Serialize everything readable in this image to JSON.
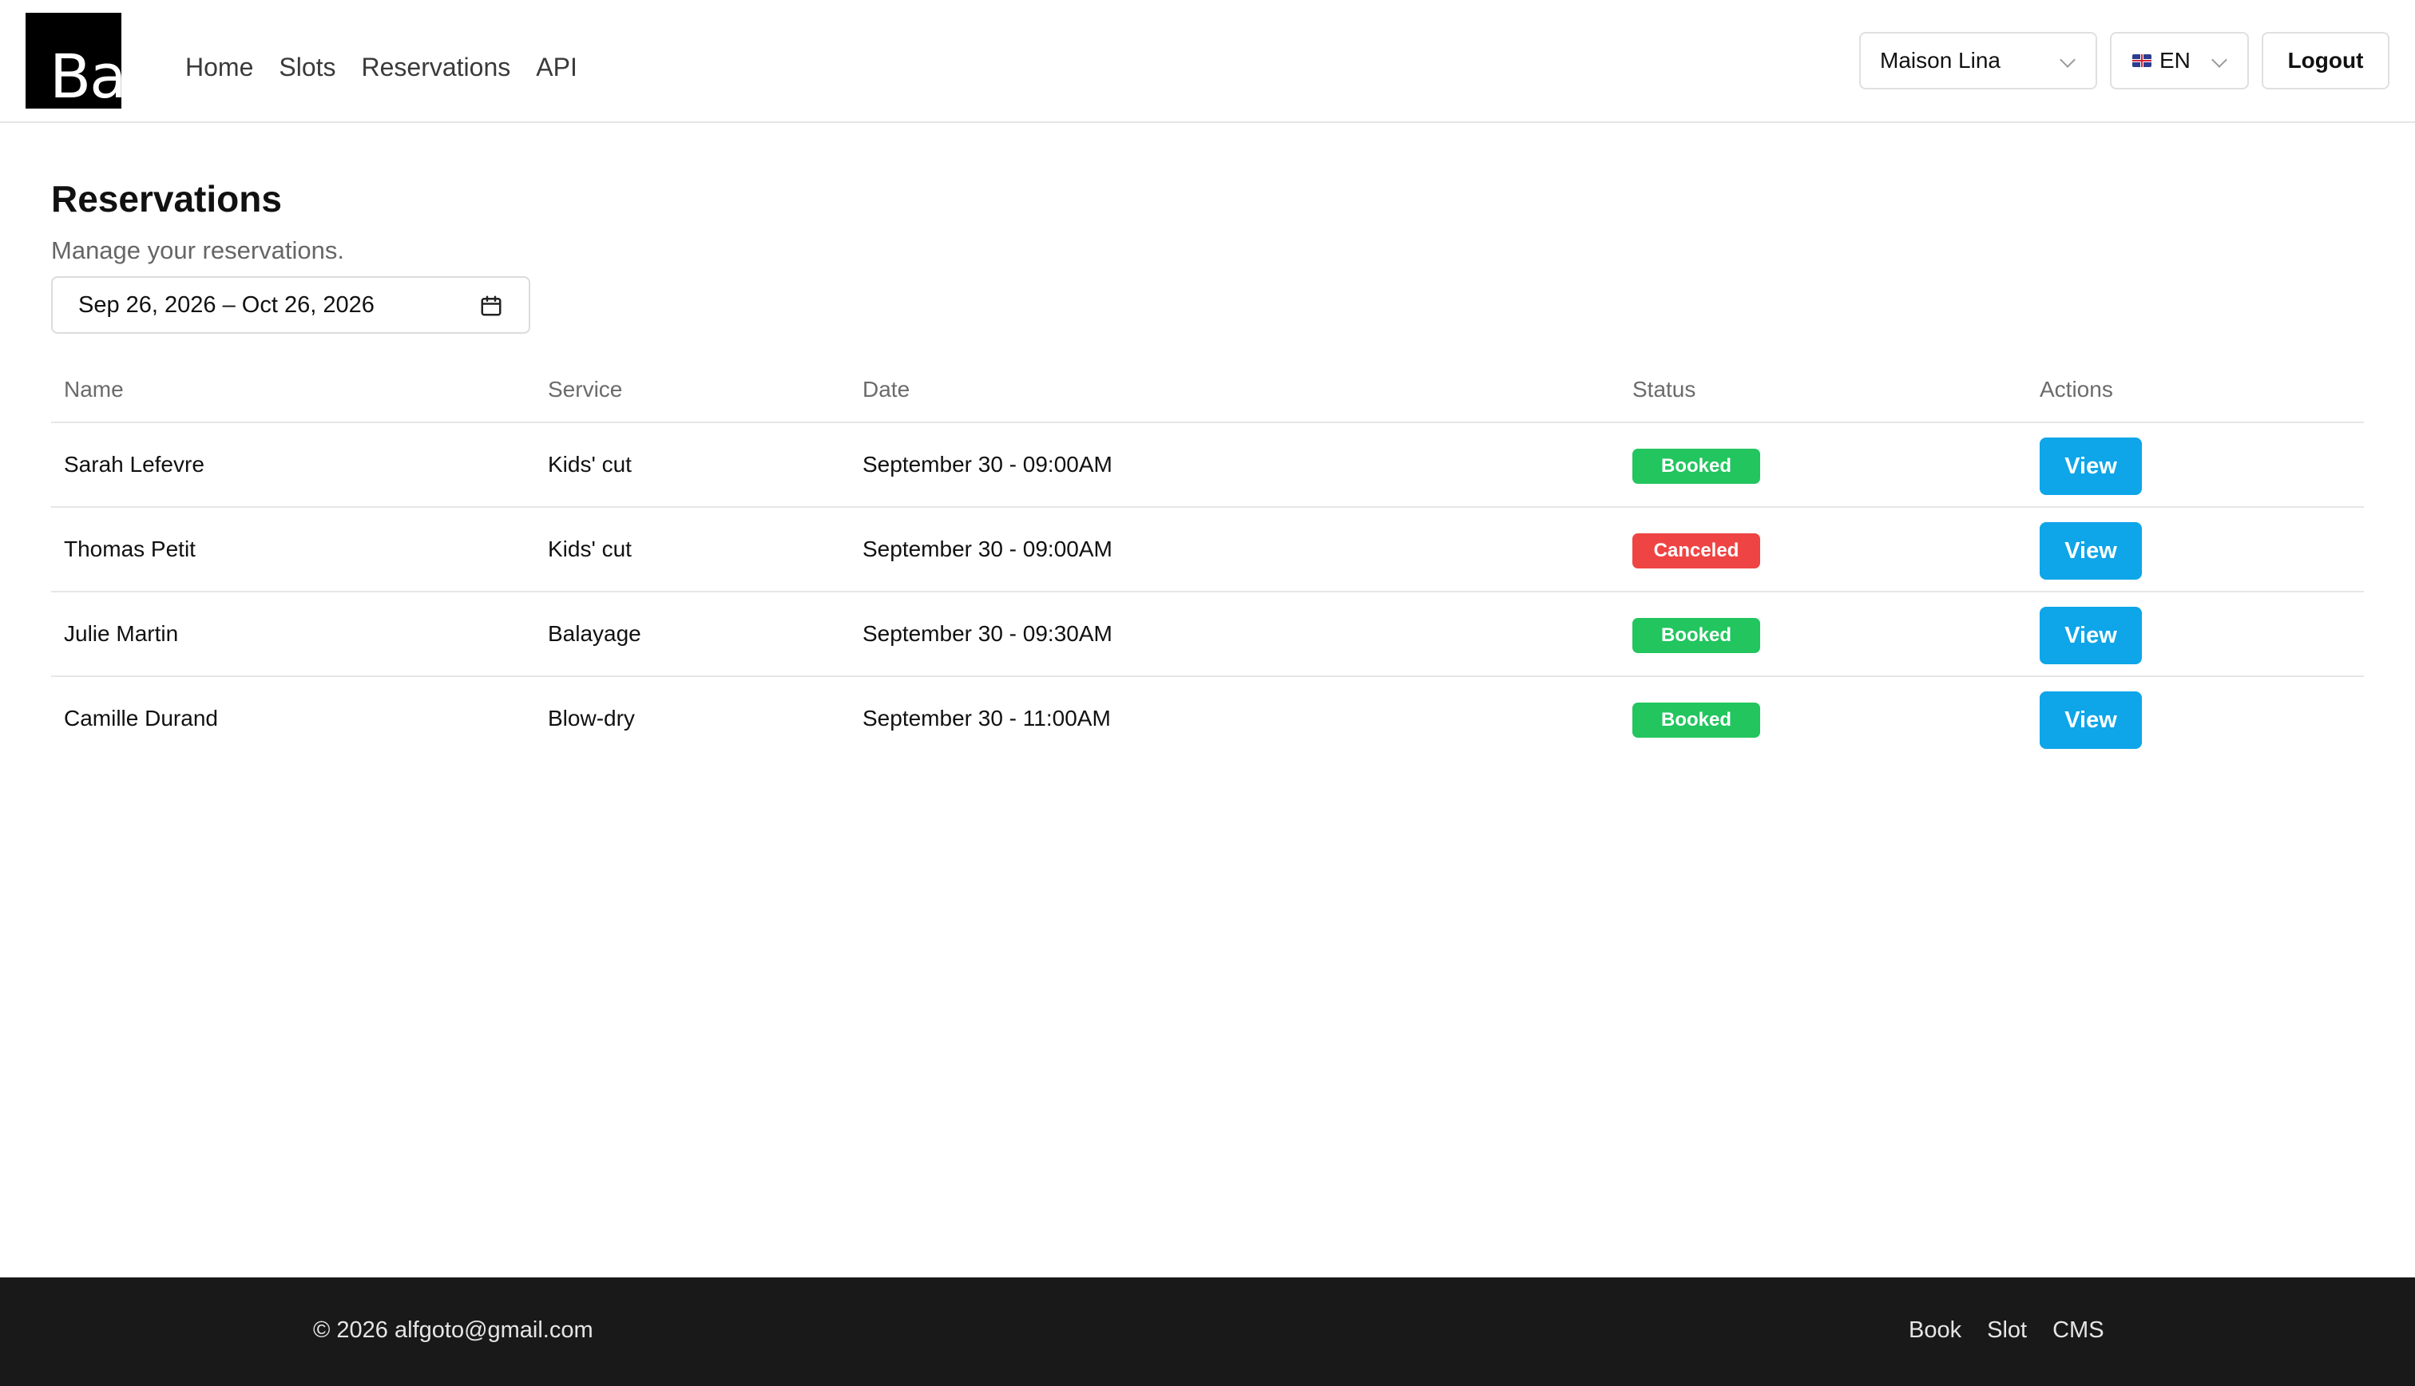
{
  "header": {
    "logo_text": "Ba",
    "nav": [
      {
        "label": "Home"
      },
      {
        "label": "Slots"
      },
      {
        "label": "Reservations"
      },
      {
        "label": "API"
      }
    ],
    "account_select": {
      "value": "Maison Lina"
    },
    "language_select": {
      "value": "EN",
      "flag_icon": "uk-flag-icon"
    },
    "logout_label": "Logout"
  },
  "main": {
    "title": "Reservations",
    "subtitle": "Manage your reservations.",
    "date_range": {
      "value": "Sep 26, 2026 – Oct 26, 2026",
      "icon": "calendar-icon"
    },
    "table": {
      "columns": [
        "Name",
        "Service",
        "Date",
        "Status",
        "Actions"
      ],
      "rows": [
        {
          "name": "Sarah Lefevre",
          "service": "Kids' cut",
          "date": "September 30 - 09:00AM",
          "status": "Booked",
          "action": "View"
        },
        {
          "name": "Thomas Petit",
          "service": "Kids' cut",
          "date": "September 30 - 09:00AM",
          "status": "Canceled",
          "action": "View"
        },
        {
          "name": "Julie Martin",
          "service": "Balayage",
          "date": "September 30 - 09:30AM",
          "status": "Booked",
          "action": "View"
        },
        {
          "name": "Camille Durand",
          "service": "Blow-dry",
          "date": "September 30 - 11:00AM",
          "status": "Booked",
          "action": "View"
        }
      ]
    }
  },
  "footer": {
    "copyright": "© 2026 alfgoto@gmail.com",
    "links": [
      {
        "label": "Book"
      },
      {
        "label": "Slot"
      },
      {
        "label": "CMS"
      }
    ]
  },
  "colors": {
    "booked": "#22c55e",
    "canceled": "#ef4444",
    "primary_button": "#0ea5e9",
    "footer_bg": "#191919"
  }
}
